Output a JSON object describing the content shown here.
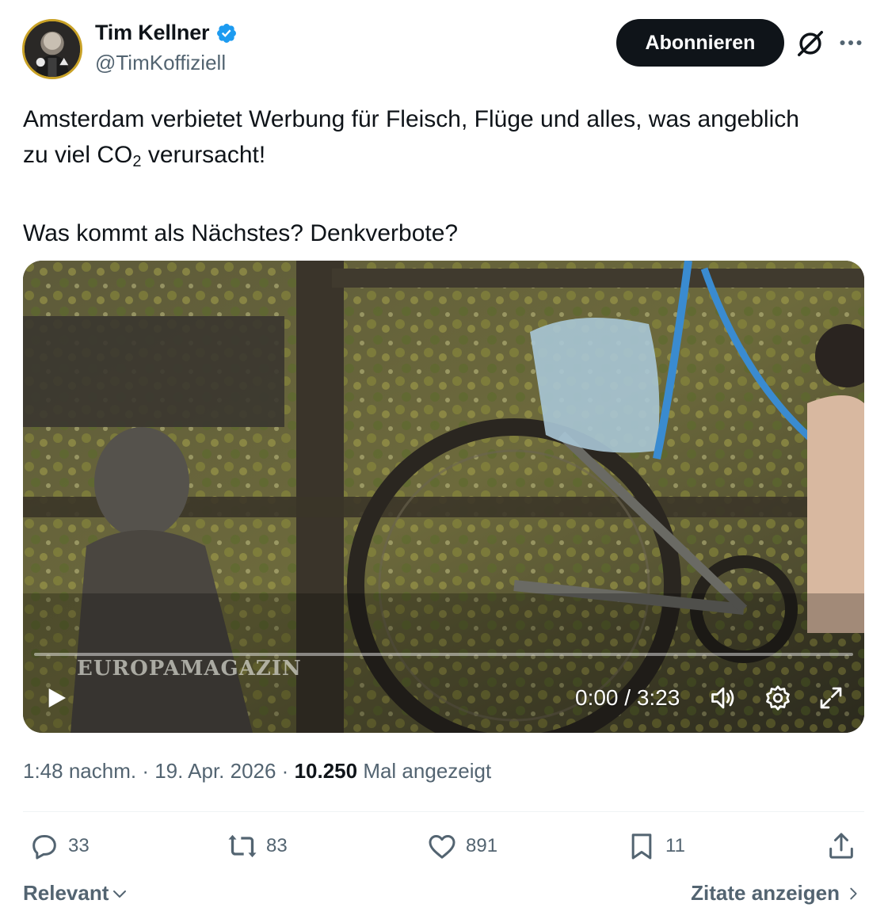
{
  "author": {
    "display_name": "Tim Kellner",
    "handle": "@TimKoffiziell",
    "verified": true,
    "avatar_icon": "avatar-photo"
  },
  "header": {
    "follow_label": "Abonnieren",
    "grok_icon": "grok-icon",
    "more_icon": "more-dots-icon"
  },
  "tweet": {
    "line1_a": "Amsterdam verbietet Werbung für Fleisch, Flüge und alles, was angeblich",
    "line2_a": "zu viel CO",
    "line2_sub": "2",
    "line2_b": " verursacht!",
    "line3": "Was kommt als Nächstes? Denkverbote?"
  },
  "video": {
    "watermark": "EUROPAMAGAZIN",
    "time": "0:00 / 3:23",
    "progress": 0.0
  },
  "meta": {
    "time": "1:48 nachm.",
    "sep1": " · ",
    "date": "19. Apr. 2026",
    "sep2": " · ",
    "views": "10.250",
    "views_label": " Mal angezeigt"
  },
  "actions": {
    "replies": "33",
    "reposts": "83",
    "likes": "891",
    "bookmarks": "11"
  },
  "footer": {
    "sort_label": "Relevant",
    "quotes_label": "Zitate anzeigen"
  },
  "colors": {
    "accent": "#1d9bf0",
    "text": "#0f1419",
    "muted": "#536471"
  }
}
